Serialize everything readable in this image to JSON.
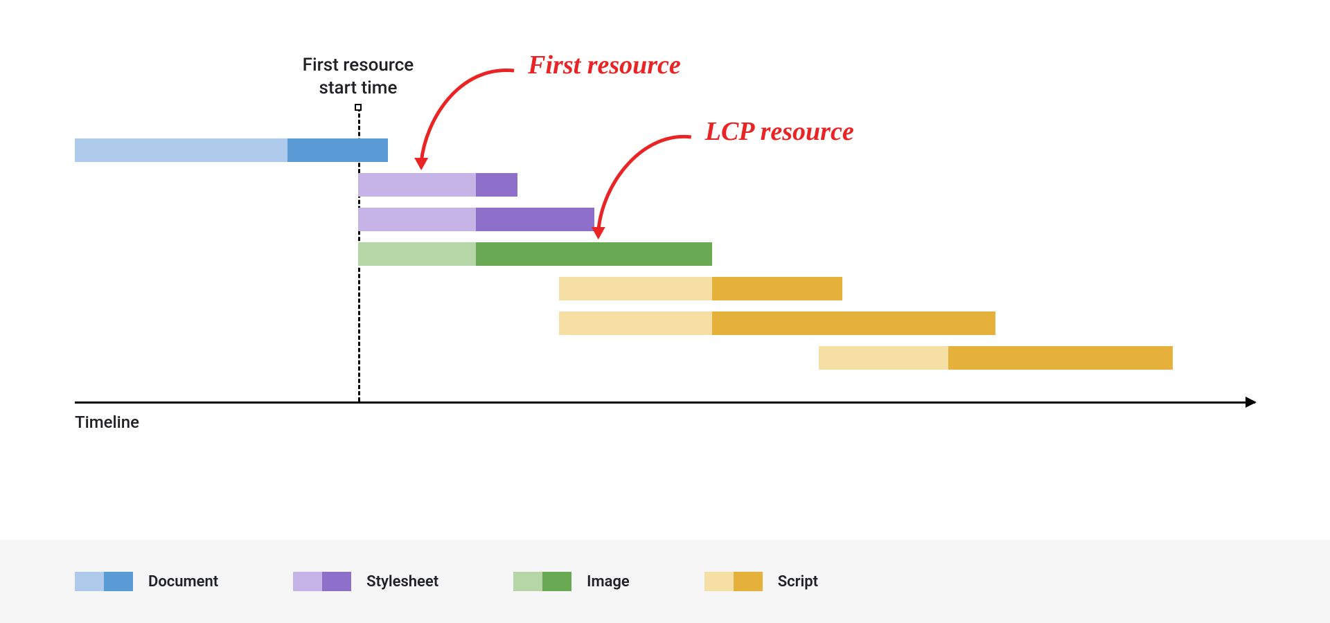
{
  "chart_data": {
    "type": "bar",
    "orientation": "horizontal-gantt",
    "x_axis_label": "Timeline",
    "categories": {
      "document": {
        "light": "#aecbeb",
        "dark": "#5b9bd5"
      },
      "stylesheet": {
        "light": "#c7b4e6",
        "dark": "#8e6fc9"
      },
      "image": {
        "light": "#b7d6a7",
        "dark": "#6aaa55"
      },
      "script": {
        "light": "#f6dfa4",
        "dark": "#e5b13a"
      }
    },
    "marker": {
      "label": "First resource\nstart time",
      "x": 24
    },
    "annotations": [
      {
        "label": "First resource",
        "points_to_row": 1
      },
      {
        "label": "LCP resource",
        "points_to_row": 3
      }
    ],
    "bars": [
      {
        "row": 0,
        "type": "document",
        "start": 0,
        "split": 18,
        "end": 26.5
      },
      {
        "row": 1,
        "type": "stylesheet",
        "start": 24,
        "split": 34,
        "end": 37.5
      },
      {
        "row": 2,
        "type": "stylesheet",
        "start": 24,
        "split": 34,
        "end": 44
      },
      {
        "row": 3,
        "type": "image",
        "start": 24,
        "split": 34,
        "end": 54
      },
      {
        "row": 4,
        "type": "script",
        "start": 41,
        "split": 54,
        "end": 65
      },
      {
        "row": 5,
        "type": "script",
        "start": 41,
        "split": 54,
        "end": 78
      },
      {
        "row": 6,
        "type": "script",
        "start": 63,
        "split": 74,
        "end": 93
      }
    ],
    "legend": [
      {
        "key": "document",
        "label": "Document"
      },
      {
        "key": "stylesheet",
        "label": "Stylesheet"
      },
      {
        "key": "image",
        "label": "Image"
      },
      {
        "key": "script",
        "label": "Script"
      }
    ]
  }
}
